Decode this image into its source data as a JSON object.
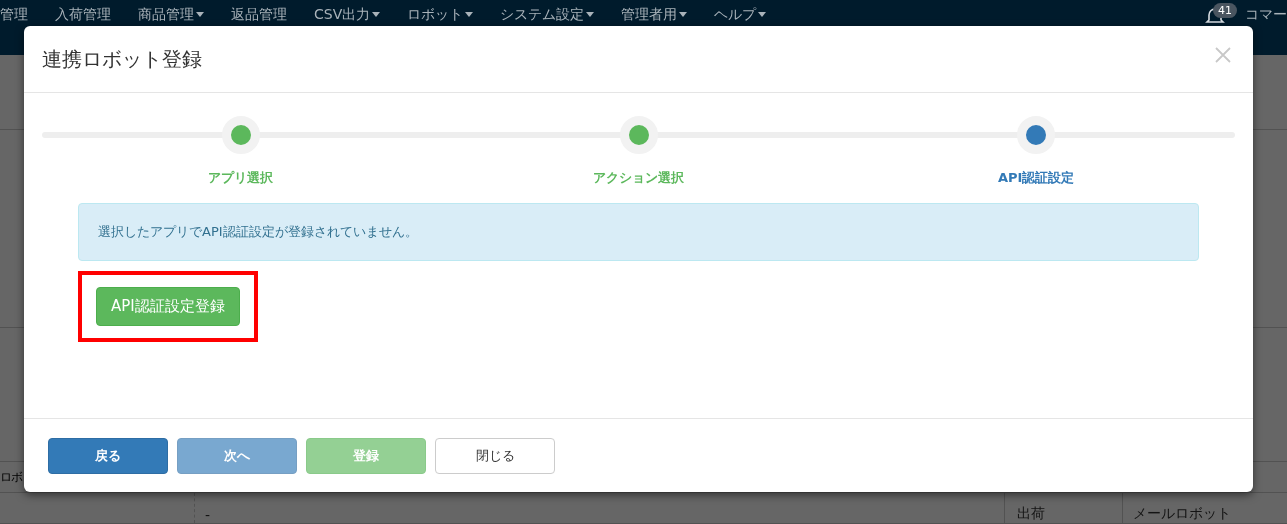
{
  "nav": {
    "items": [
      {
        "label": "管理",
        "has_menu": false
      },
      {
        "label": "入荷管理",
        "has_menu": false
      },
      {
        "label": "商品管理",
        "has_menu": true
      },
      {
        "label": "返品管理",
        "has_menu": false
      },
      {
        "label": "CSV出力",
        "has_menu": true
      },
      {
        "label": "ロボット",
        "has_menu": true
      },
      {
        "label": "システム設定",
        "has_menu": true
      },
      {
        "label": "管理者用",
        "has_menu": true
      },
      {
        "label": "ヘルプ",
        "has_menu": true
      }
    ],
    "notification_count": "41",
    "user": "コマー"
  },
  "background_table": {
    "header": [
      "ロボ"
    ],
    "row": [
      "-",
      "出荷",
      "メールロボット"
    ]
  },
  "modal": {
    "title": "連携ロボット登録",
    "steps": [
      {
        "label": "アプリ選択",
        "selected": false
      },
      {
        "label": "アクション選択",
        "selected": false
      },
      {
        "label": "API認証設定",
        "selected": true
      }
    ],
    "alert": "選択したアプリでAPI認証設定が登録されていません。",
    "action_button": {
      "label": "API認証設定登録",
      "highlighted": true
    },
    "buttons": [
      {
        "label": "戻る",
        "kind": "primary",
        "disabled": false
      },
      {
        "label": "次へ",
        "kind": "primary",
        "disabled": true
      },
      {
        "label": "登録",
        "kind": "success",
        "disabled": true
      },
      {
        "label": "閉じる",
        "kind": "default",
        "disabled": false
      }
    ]
  }
}
